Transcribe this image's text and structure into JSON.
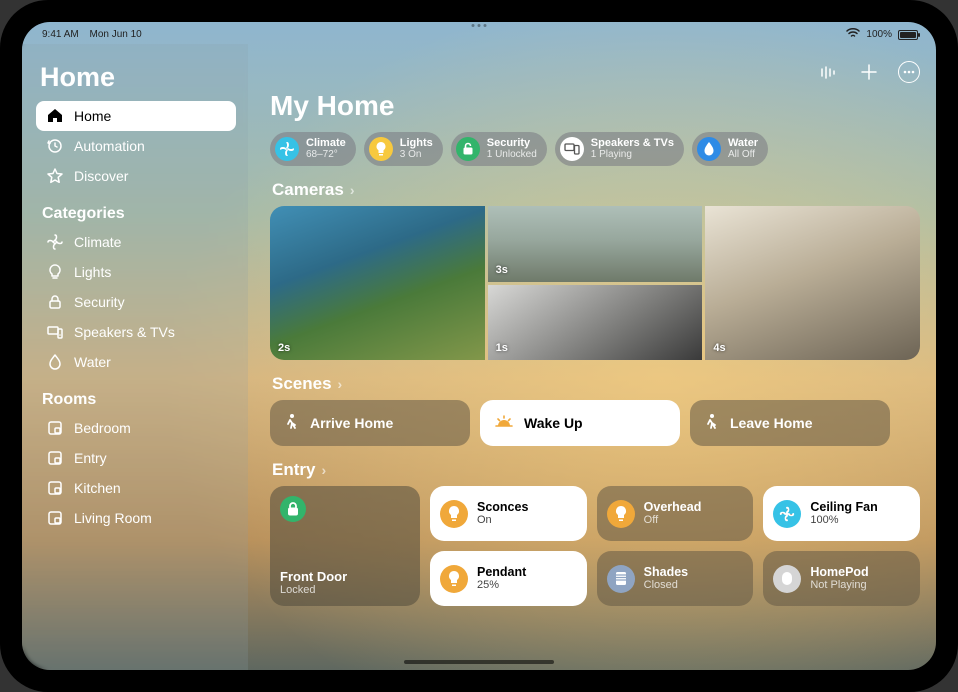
{
  "status": {
    "time": "9:41 AM",
    "date": "Mon Jun 10",
    "battery": "100%"
  },
  "sidebar": {
    "title": "Home",
    "nav": [
      {
        "id": "home",
        "label": "Home",
        "icon": "house-icon",
        "active": true
      },
      {
        "id": "automation",
        "label": "Automation",
        "icon": "clock-arrow-icon",
        "active": false
      },
      {
        "id": "discover",
        "label": "Discover",
        "icon": "star-icon",
        "active": false
      }
    ],
    "categories_header": "Categories",
    "categories": [
      {
        "id": "climate",
        "label": "Climate",
        "icon": "fan-icon"
      },
      {
        "id": "lights",
        "label": "Lights",
        "icon": "bulb-icon"
      },
      {
        "id": "security",
        "label": "Security",
        "icon": "lock-icon"
      },
      {
        "id": "speakers",
        "label": "Speakers & TVs",
        "icon": "tv-speaker-icon"
      },
      {
        "id": "water",
        "label": "Water",
        "icon": "drop-icon"
      }
    ],
    "rooms_header": "Rooms",
    "rooms": [
      {
        "id": "bedroom",
        "label": "Bedroom",
        "icon": "room-icon"
      },
      {
        "id": "entry",
        "label": "Entry",
        "icon": "room-icon"
      },
      {
        "id": "kitchen",
        "label": "Kitchen",
        "icon": "room-icon"
      },
      {
        "id": "livingroom",
        "label": "Living Room",
        "icon": "room-icon"
      }
    ]
  },
  "main": {
    "title": "My Home",
    "chips": [
      {
        "id": "climate",
        "label": "Climate",
        "sub": "68–72°",
        "color": "#36c2e6",
        "icon": "fan-icon"
      },
      {
        "id": "lights",
        "label": "Lights",
        "sub": "3 On",
        "color": "#f7c93e",
        "icon": "bulb-icon"
      },
      {
        "id": "security",
        "label": "Security",
        "sub": "1 Unlocked",
        "color": "#32b46b",
        "icon": "lock-icon"
      },
      {
        "id": "speakers",
        "label": "Speakers & TVs",
        "sub": "1 Playing",
        "color": "#ffffff",
        "icon": "tv-speaker-icon"
      },
      {
        "id": "water",
        "label": "Water",
        "sub": "All Off",
        "color": "#2e8be6",
        "icon": "drop-icon"
      }
    ],
    "cameras": {
      "header": "Cameras",
      "items": [
        {
          "id": "pool",
          "ts": "2s"
        },
        {
          "id": "drive",
          "ts": "3s"
        },
        {
          "id": "garage",
          "ts": "1s"
        },
        {
          "id": "living",
          "ts": "4s"
        }
      ]
    },
    "scenes": {
      "header": "Scenes",
      "items": [
        {
          "id": "arrive",
          "label": "Arrive Home",
          "on": false,
          "icon": "person-walk-icon"
        },
        {
          "id": "wakeup",
          "label": "Wake Up",
          "on": true,
          "icon": "sunrise-icon"
        },
        {
          "id": "leave",
          "label": "Leave Home",
          "on": false,
          "icon": "person-walk-icon"
        }
      ]
    },
    "entry": {
      "header": "Entry",
      "lock": {
        "title": "Front Door",
        "sub": "Locked"
      },
      "tiles": [
        [
          {
            "id": "sconces",
            "label": "Sconces",
            "sub": "On",
            "on": true,
            "iconColor": "#f0a83a",
            "icon": "bulb-icon"
          },
          {
            "id": "overhead",
            "label": "Overhead",
            "sub": "Off",
            "on": false,
            "iconColor": "#f0a83a",
            "icon": "bulb-icon"
          },
          {
            "id": "fan",
            "label": "Ceiling Fan",
            "sub": "100%",
            "on": true,
            "iconColor": "#36c2e6",
            "icon": "fan-icon"
          }
        ],
        [
          {
            "id": "pendant",
            "label": "Pendant",
            "sub": "25%",
            "on": true,
            "iconColor": "#f0a83a",
            "icon": "bulb-icon"
          },
          {
            "id": "shades",
            "label": "Shades",
            "sub": "Closed",
            "on": false,
            "iconColor": "#8fa4c2",
            "icon": "shades-icon"
          },
          {
            "id": "homepod",
            "label": "HomePod",
            "sub": "Not Playing",
            "on": false,
            "iconColor": "#d5d5d5",
            "icon": "homepod-icon"
          }
        ]
      ]
    }
  }
}
